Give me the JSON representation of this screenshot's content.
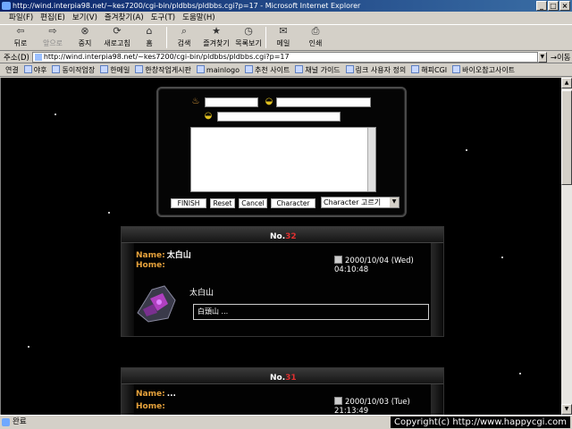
{
  "window": {
    "title": "http://wind.interpia98.net/~kes7200/cgi-bin/pldbbs/pldbbs.cgi?p=17 - Microsoft Internet Explorer",
    "controls": [
      "_",
      "□",
      "×"
    ]
  },
  "menu": [
    "파일(F)",
    "편집(E)",
    "보기(V)",
    "즐겨찾기(A)",
    "도구(T)",
    "도움말(H)"
  ],
  "toolbar": {
    "back": "뒤로",
    "forward": "앞으로",
    "stop": "중지",
    "refresh": "새로고침",
    "home": "홈",
    "search": "검색",
    "favorites": "즐겨찾기",
    "history": "목록보기",
    "mail": "메일",
    "print": "인쇄"
  },
  "address": {
    "label": "주소(D)",
    "url": "http://wind.interpia98.net/~kes7200/cgi-bin/pldbbs/pldbbs.cgi?p=17",
    "go": "이동"
  },
  "links": {
    "label": "연결",
    "items": [
      "야후",
      "동이작업장",
      "한메일",
      "한창작업게시판",
      "mainlogo",
      "추천 사이트",
      "채널 가이드",
      "링크 사용자 정의",
      "해피CGI",
      "바이오참고사이트"
    ]
  },
  "form": {
    "buttons": {
      "finish": "FINISH",
      "reset": "Reset",
      "cancel": "Cancel",
      "character": "Character"
    },
    "select_value": "Character 고르기"
  },
  "posts": [
    {
      "no_label": "No.",
      "number": "32",
      "name_label": "Name:",
      "name": "太白山",
      "home_label": "Home:",
      "home": "",
      "date": "2000/10/04 (Wed) 04:10:48",
      "body": "太白山",
      "reply": "白頭山 ..."
    },
    {
      "no_label": "No.",
      "number": "31",
      "name_label": "Name:",
      "name": "...",
      "home_label": "Home:",
      "home": "",
      "date": "2000/10/03 (Tue) 21:13:49"
    }
  ],
  "status": {
    "text": "완료",
    "copyright": "Copyright(c) http://www.happycgi.com"
  },
  "colors": {
    "titlebar": "#0a246a",
    "label_orange": "#e6a23c",
    "number_red": "#e03030",
    "page_bg": "#000000"
  }
}
